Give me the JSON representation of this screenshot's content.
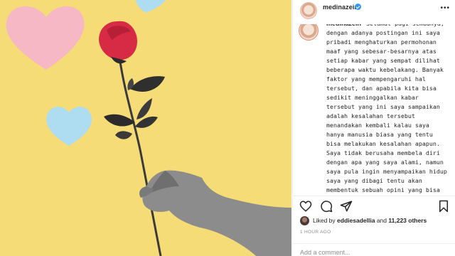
{
  "post": {
    "username": "medinazein",
    "caption": "Selamat pagi semuanya, dengan adanya postingan ini saya pribadi menghaturkan permohonan maaf yang sebesar-besarnya atas setiap kabar yang sempat dilihat beberapa waktu kebelakang. Banyak faktor yang mempengaruhi hal tersebut, dan apabila kita bisa sedikit meninggalkan kabar tersebut yang ini saya sampaikan adalah kesalahan tersebut menandakan kembali kalau saya hanya manusia biasa yang tentu bisa melakukan kesalahan apapun. Saya tidak berusaha membela diri dengan apa yang saya alami, namun saya pula ingin menyampaikan hidup saya yang dibagi tentu akan membentuk sebuah opini yang bisa diikuti dan ditinggalkan. Tentu pelajaran kemarin",
    "liked_by_user": "eddiesadellia",
    "likes_connector": "and",
    "likes_count": "11,223 others",
    "liked_by_prefix": "Liked by",
    "timestamp": "1 HOUR AGO",
    "more_label": "•••"
  },
  "comment": {
    "placeholder": "Add a comment..."
  },
  "icons": {
    "verified": "verified-badge-icon",
    "like": "heart-icon",
    "comment": "comment-icon",
    "share": "share-icon",
    "save": "bookmark-icon",
    "more": "more-options-icon"
  },
  "colors": {
    "photo_background": "#f5dc77",
    "heart_pink": "#f5b8c4",
    "heart_blue": "#aedcf0",
    "rose_red": "#d72a45",
    "verified_blue": "#3897f0",
    "secondary_text": "#8e8e8e"
  }
}
